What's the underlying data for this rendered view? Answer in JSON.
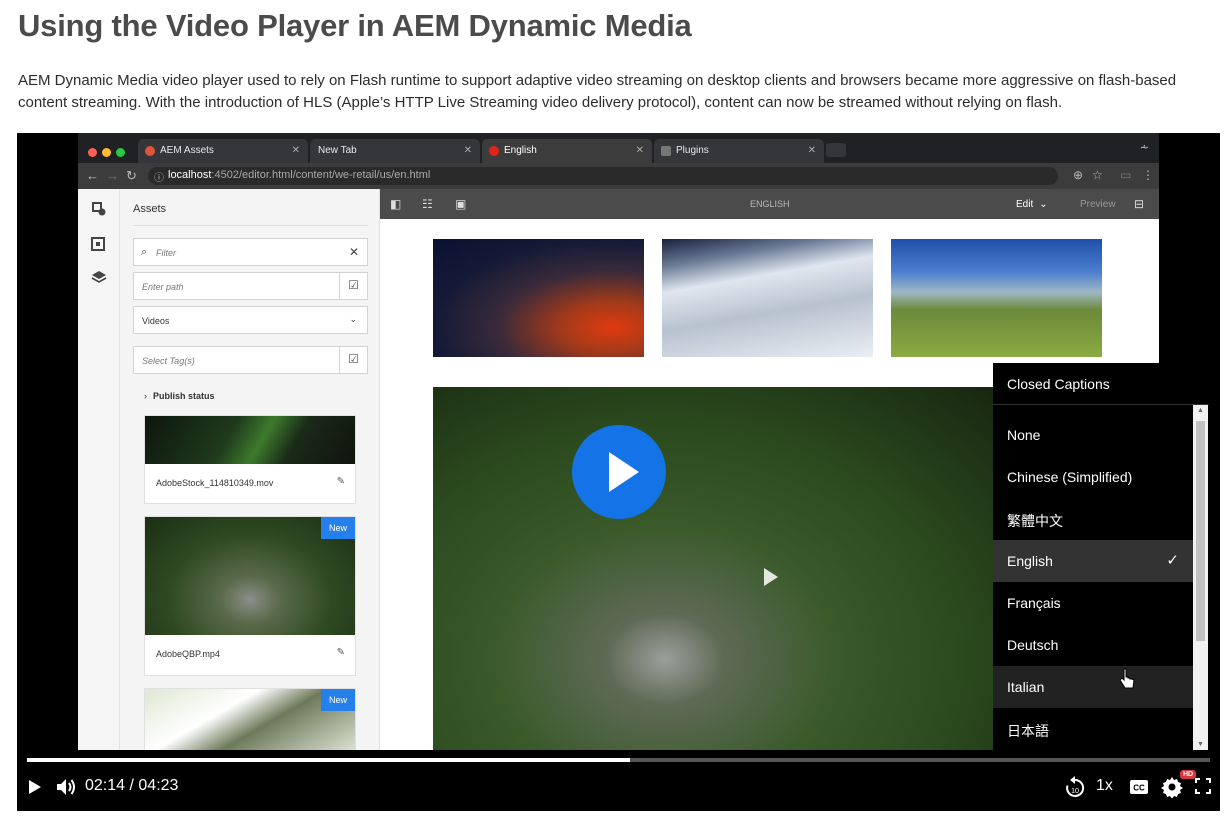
{
  "article": {
    "title": "Using the Video Player in AEM Dynamic Media",
    "intro": "AEM Dynamic Media video player used to rely on Flash runtime to support adaptive video streaming on desktop clients and browsers became more aggressive on flash-based content streaming. With the introduction of HLS (Apple’s HTTP Live Streaming video delivery protocol), content can now be streamed without relying on flash."
  },
  "browser": {
    "tabs": [
      "AEM Assets",
      "New Tab",
      "English",
      "Plugins"
    ],
    "url_host": "localhost",
    "url_rest": ":4502/editor.html/content/we-retail/us/en.html"
  },
  "aem": {
    "panel_title": "Assets",
    "filter_placeholder": "Filter",
    "path_placeholder": "Enter path",
    "asset_type": "Videos",
    "tags_placeholder": "Select Tag(s)",
    "publish_status": "Publish status",
    "cards": [
      {
        "name": "AdobeStock_114810349.mov",
        "badge": ""
      },
      {
        "name": "AdobeQBP.mp4",
        "badge": "New"
      },
      {
        "name": "",
        "badge": "New"
      }
    ],
    "editor_label": "ENGLISH",
    "mode": "Edit",
    "preview": "Preview"
  },
  "captions": {
    "header": "Closed Captions",
    "items": [
      "None",
      "Chinese (Simplified)",
      "繁體中文",
      "English",
      "Français",
      "Deutsch",
      "Italian",
      "日本語"
    ],
    "selected": "English",
    "check": "✓"
  },
  "player": {
    "current_time": "02:14",
    "separator": " / ",
    "duration": "04:23",
    "speed": "1x",
    "hd_badge": "HD",
    "progress_fraction": 0.51
  },
  "colors": {
    "accent": "#1473e6",
    "hd_badge": "#d7373f"
  }
}
